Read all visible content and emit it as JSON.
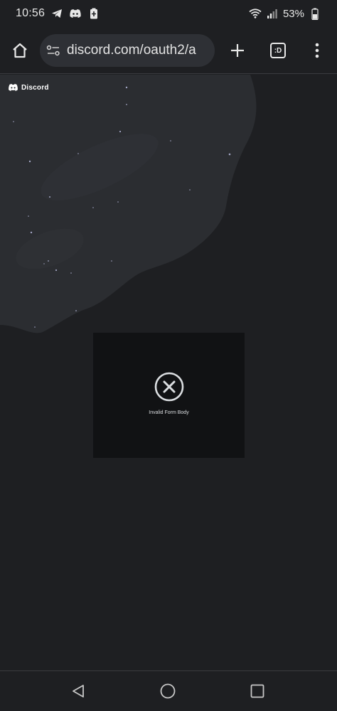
{
  "status_bar": {
    "time": "10:56",
    "battery_percent": "53%",
    "notification_icons": [
      "telegram-icon",
      "discord-icon",
      "battery-saver-icon"
    ],
    "system_icons": [
      "wifi-icon",
      "signal-icon",
      "battery-icon"
    ]
  },
  "browser": {
    "url": "discord.com/oauth2/a",
    "tab_label": ":D",
    "icons": [
      "home-icon",
      "site-settings-icon",
      "plus-icon",
      "tab-switcher-icon",
      "more-vert-icon"
    ]
  },
  "page": {
    "brand": "Discord",
    "error_message": "Invalid Form Body",
    "colors": {
      "background": "#1e1f22",
      "card": "#111214",
      "hero": "#2b2d31"
    }
  },
  "nav_bar": {
    "icons": [
      "back-triangle-icon",
      "home-circle-icon",
      "recents-square-icon"
    ]
  }
}
